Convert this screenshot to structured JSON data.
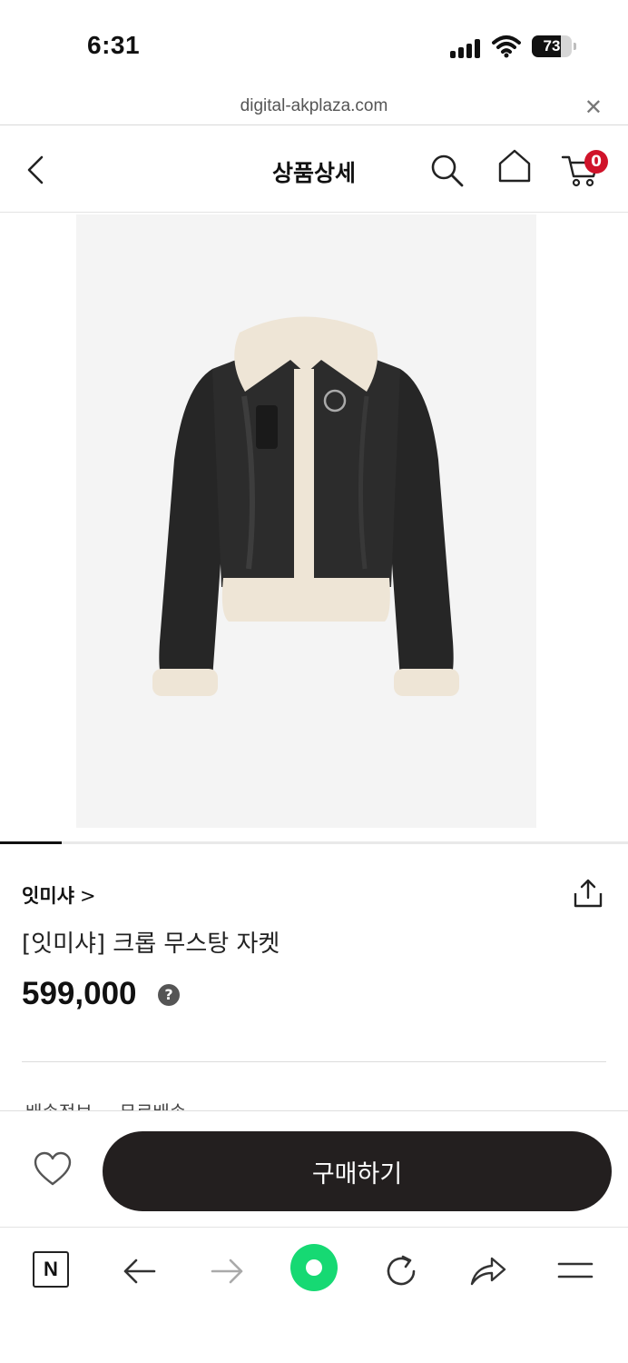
{
  "status_bar": {
    "time": "6:31",
    "battery_level": "73",
    "battery_fraction": 0.73
  },
  "browser": {
    "url": "digital-akplaza.com",
    "close_icon": "close-icon",
    "toolbar_icons": [
      "naver-home-icon",
      "back-arrow-icon",
      "forward-arrow-icon",
      "green-dot-icon",
      "reload-icon",
      "share-arrow-icon",
      "menu-icon"
    ],
    "naver_label": "N"
  },
  "header": {
    "title": "상품상세",
    "cart_count": "0",
    "badge_color": "#d0132a"
  },
  "product": {
    "brand": "잇미샤",
    "brand_chevron": ">",
    "name": "[잇미샤]  크롭 무스탕 자켓",
    "price": "599,000",
    "price_help": "?",
    "image_alt": "black leather shearling jacket"
  },
  "shipping": {
    "label": "배송정보",
    "value": "무료배송"
  },
  "buy_bar": {
    "buy_label": "구매하기",
    "button_color": "#231f1f"
  },
  "accent": {
    "green": "#16d973"
  }
}
